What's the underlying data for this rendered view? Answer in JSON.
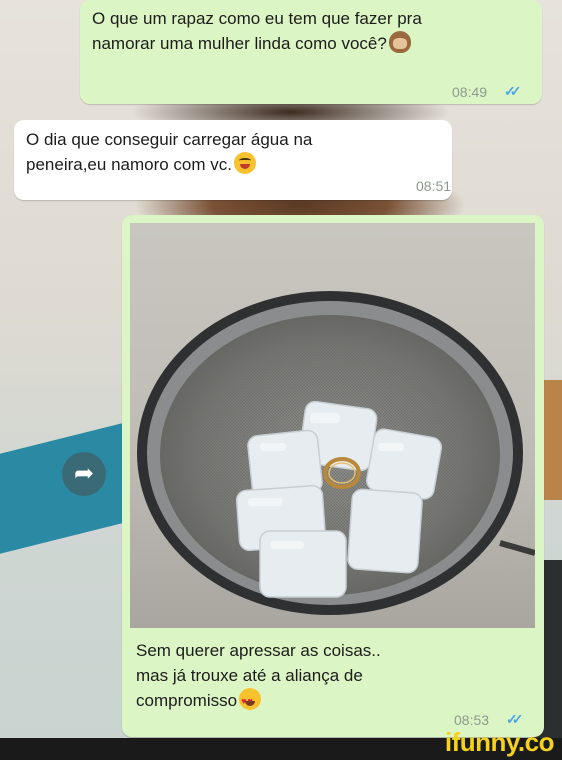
{
  "messages": [
    {
      "direction": "outgoing",
      "lines": [
        "O que um rapaz como eu tem que fazer pra",
        "namorar uma mulher linda como você?"
      ],
      "emoji": "see-no-evil-monkey-icon",
      "time": "08:49",
      "read_ticks": "✓✓"
    },
    {
      "direction": "incoming",
      "lines": [
        "O dia que conseguir carregar água na",
        "peneira,eu namoro com vc."
      ],
      "emoji": "winking-tongue-face-icon",
      "time": "08:51"
    },
    {
      "direction": "outgoing",
      "type": "image",
      "image_description": "sieve-with-ice-cubes-and-ring",
      "caption_lines": [
        "Sem querer apressar as coisas..",
        "mas já trouxe até a aliança de",
        "compromisso"
      ],
      "emoji": "heart-eyes-face-icon",
      "time": "08:53",
      "read_ticks": "✓✓"
    }
  ],
  "share_icon": "➦",
  "watermark": "ifunny.co",
  "colors": {
    "outgoing_bubble": "#dcf5c4",
    "incoming_bubble": "#ffffff",
    "read_ticks": "#4fa6e6",
    "watermark": "#f7d21a"
  }
}
